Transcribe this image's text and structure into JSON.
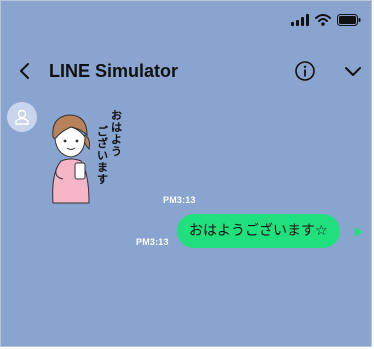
{
  "header": {
    "title": "LINE Simulator",
    "back_icon": "chevron-left-icon",
    "info_icon": "info-icon",
    "menu_icon": "chevron-down-icon"
  },
  "status_bar": {
    "icons": [
      "signal-icon",
      "wifi-icon",
      "battery-icon"
    ]
  },
  "chat": {
    "messages": [
      {
        "sender": "other",
        "type": "sticker",
        "sticker_text": "おはようございます",
        "time": "PM3:13"
      },
      {
        "sender": "self",
        "type": "text",
        "text": "おはようございます☆",
        "time": "PM3:13"
      }
    ]
  },
  "colors": {
    "background": "#8aa4d0",
    "bubble_self": "#20e07e",
    "avatar_bg": "#c9d5ec"
  }
}
